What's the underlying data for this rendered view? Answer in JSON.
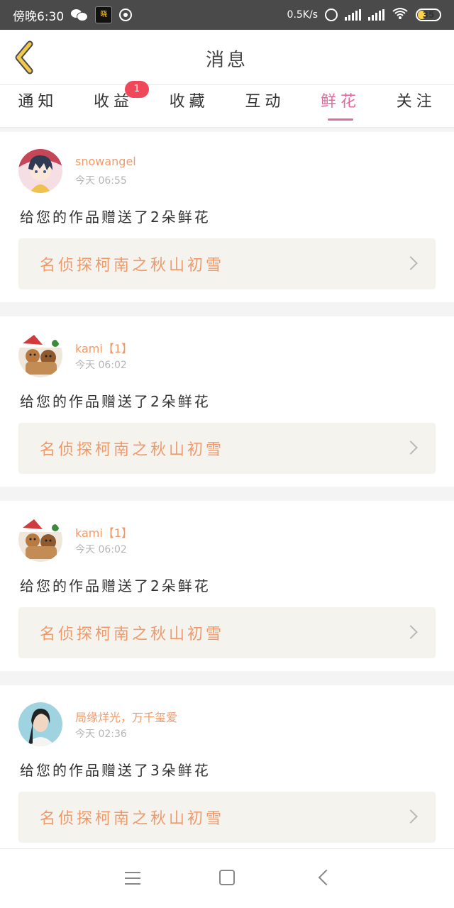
{
  "status_bar": {
    "time": "傍晚6:30",
    "app_icon_text": "晓",
    "net_speed": "0.5K/s",
    "battery": "35",
    "icons": [
      "wechat-icon",
      "app-icon",
      "hotspot-icon",
      "alarm-icon",
      "signal-icon",
      "signal-icon",
      "wifi-icon",
      "battery-icon"
    ]
  },
  "header": {
    "title": "消息",
    "back_icon": "back-chevron-icon",
    "accent_color": "#f2c94c"
  },
  "tabs": [
    {
      "label": "通知"
    },
    {
      "label": "收益",
      "badge": "1"
    },
    {
      "label": "收藏"
    },
    {
      "label": "互动"
    },
    {
      "label": "鲜花",
      "active": true
    },
    {
      "label": "关注"
    }
  ],
  "active_color": "#e06c9f",
  "feed": [
    {
      "user": "snowangel",
      "time": "今天 06:55",
      "message": "给您的作品赠送了2朵鲜花",
      "work": "名侦探柯南之秋山初雪",
      "avatar": "anime-avatar"
    },
    {
      "user": "kami【1】",
      "time": "今天 06:02",
      "message": "给您的作品赠送了2朵鲜花",
      "work": "名侦探柯南之秋山初雪",
      "avatar": "gingerbread-avatar"
    },
    {
      "user": "kami【1】",
      "time": "今天 06:02",
      "message": "给您的作品赠送了2朵鲜花",
      "work": "名侦探柯南之秋山初雪",
      "avatar": "gingerbread-avatar"
    },
    {
      "user": "局缘烊光，万千玺爱",
      "time": "今天 02:36",
      "message": "给您的作品赠送了3朵鲜花",
      "work": "名侦探柯南之秋山初雪",
      "avatar": "portrait-avatar"
    }
  ],
  "nav_bar": {
    "icons": [
      "menu-icon",
      "home-icon",
      "back-icon"
    ]
  }
}
